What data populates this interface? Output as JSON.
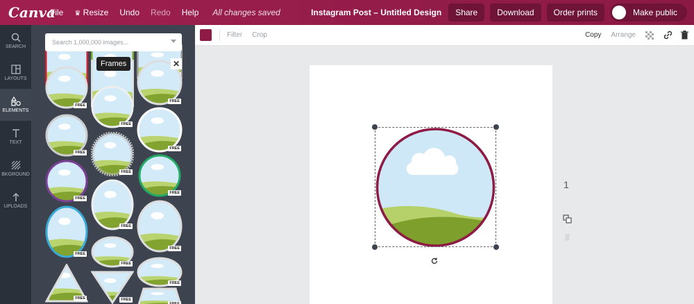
{
  "app": {
    "logo": "Canva"
  },
  "topbar": {
    "file": "File",
    "resize": "Resize",
    "undo": "Undo",
    "redo": "Redo",
    "help": "Help",
    "saved": "All changes saved",
    "design_title": "Instagram Post – Untitled Design",
    "share": "Share",
    "download": "Download",
    "order_prints": "Order prints",
    "make_public": "Make public"
  },
  "sidebar": {
    "items": [
      {
        "label": "SEARCH",
        "icon": "search-icon"
      },
      {
        "label": "LAYOUTS",
        "icon": "layouts-icon"
      },
      {
        "label": "ELEMENTS",
        "icon": "elements-icon",
        "active": true
      },
      {
        "label": "TEXT",
        "icon": "text-icon"
      },
      {
        "label": "BKGROUND",
        "icon": "background-icon"
      },
      {
        "label": "UPLOADS",
        "icon": "upload-icon"
      }
    ]
  },
  "panel": {
    "search_placeholder": "Search 1,000,000 images...",
    "tooltip": "Frames",
    "free_badge": "FREE"
  },
  "canvas_toolbar": {
    "color": "#8d1b45",
    "filter": "Filter",
    "crop": "Crop",
    "copy": "Copy",
    "arrange": "Arrange"
  },
  "canvas": {
    "page_number": "1"
  },
  "colors": {
    "brand": "#8d1b45",
    "sidebar": "#293039",
    "panel": "#3d4450"
  }
}
